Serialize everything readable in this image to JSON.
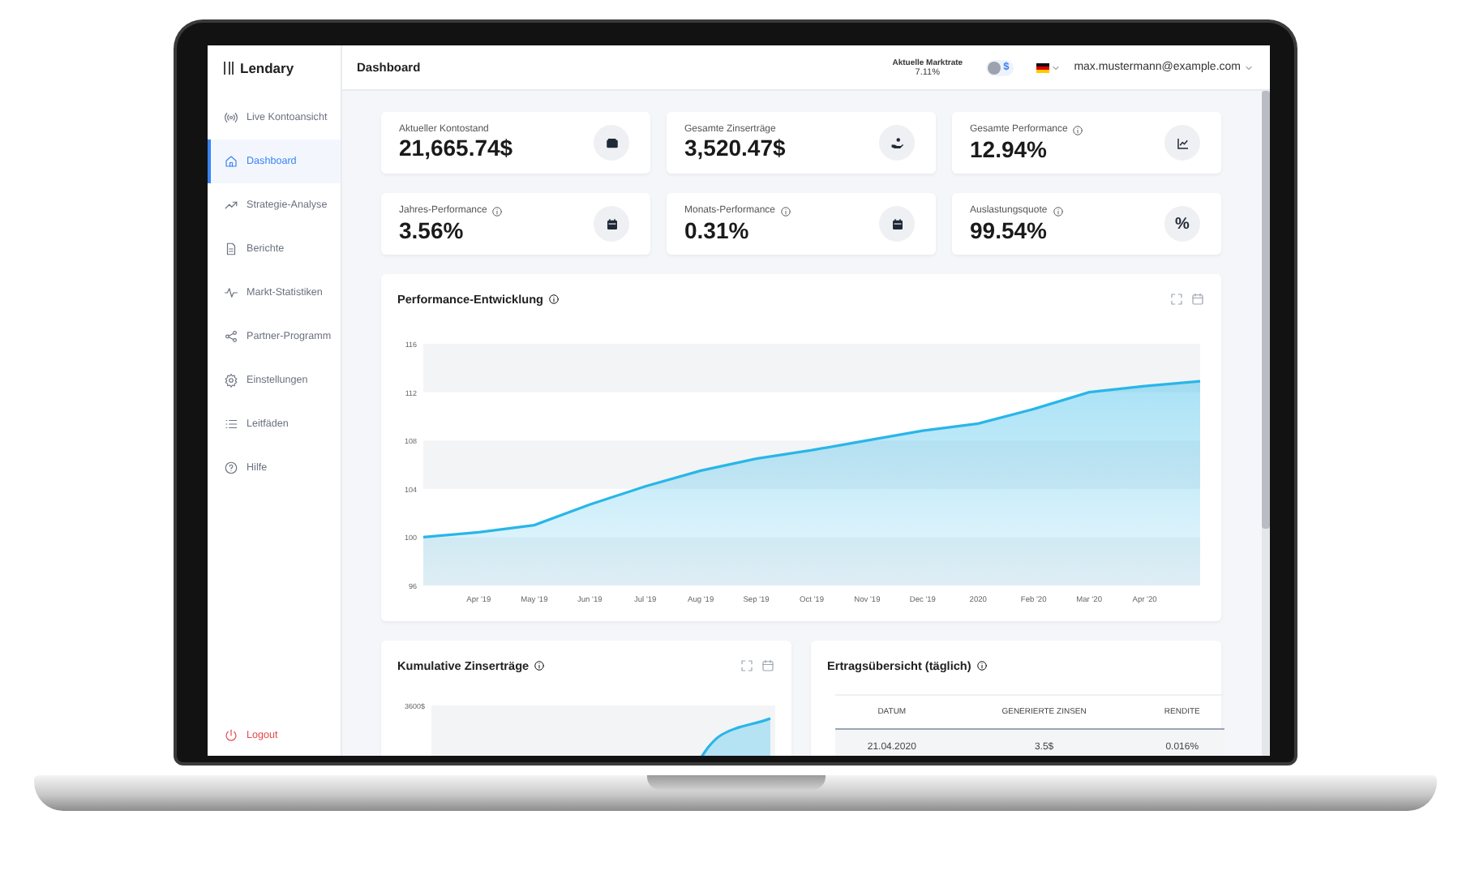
{
  "app": {
    "logo": "Lendary"
  },
  "sidebar": {
    "items": [
      {
        "label": "Live Kontoansicht",
        "kind": "broadcast",
        "selected": false
      },
      {
        "label": "Dashboard",
        "kind": "home",
        "selected": true
      },
      {
        "label": "Strategie-Analyse",
        "kind": "trend",
        "selected": false
      },
      {
        "label": "Berichte",
        "kind": "document",
        "selected": false
      },
      {
        "label": "Markt-Statistiken",
        "kind": "pulse",
        "selected": false
      },
      {
        "label": "Partner-Programm",
        "kind": "share",
        "selected": false
      },
      {
        "label": "Einstellungen",
        "kind": "gear",
        "selected": false
      },
      {
        "label": "Leitfäden",
        "kind": "list",
        "selected": false
      },
      {
        "label": "Hilfe",
        "kind": "help",
        "selected": false
      }
    ],
    "logout": "Logout"
  },
  "topbar": {
    "title": "Dashboard",
    "market_rate": {
      "label": "Aktuelle Marktrate",
      "value": "7.11%"
    },
    "currency": "$",
    "user": "max.mustermann@example.com"
  },
  "stats": [
    {
      "label": "Aktueller Kontostand",
      "value": "21,665.74$",
      "info": false,
      "kind": "wallet"
    },
    {
      "label": "Gesamte Zinserträge",
      "value": "3,520.47$",
      "info": false,
      "kind": "hand"
    },
    {
      "label": "Gesamte Performance",
      "value": "12.94%",
      "info": true,
      "kind": "chart"
    },
    {
      "label": "Jahres-Performance",
      "value": "3.56%",
      "info": true,
      "kind": "calendar"
    },
    {
      "label": "Monats-Performance",
      "value": "0.31%",
      "info": true,
      "kind": "calendar"
    },
    {
      "label": "Auslastungsquote",
      "value": "99.54%",
      "info": true,
      "kind": "symbol",
      "symbol": "%"
    }
  ],
  "performance_chart": {
    "title": "Performance-Entwicklung",
    "chart_data": {
      "type": "area",
      "categories": [
        null,
        "Apr '19",
        "May '19",
        "Jun '19",
        "Jul '19",
        "Aug '19",
        "Sep '19",
        "Oct '19",
        "Nov '19",
        "Dec '19",
        "2020",
        "Feb '20",
        "Mar '20",
        "Apr '20",
        null
      ],
      "series": [
        {
          "color": "#29b6e8",
          "values": [
            100,
            100.4,
            101,
            102.7,
            104.2,
            105.5,
            106.5,
            107.2,
            108,
            108.8,
            109.4,
            110.6,
            112,
            112.5,
            112.9
          ]
        }
      ],
      "ylim": [
        96,
        116
      ],
      "yticks": [
        96,
        100,
        104,
        108,
        112,
        116
      ]
    }
  },
  "cumulative_chart": {
    "title": "Kumulative Zinserträge",
    "y_tick": "3600$"
  },
  "earnings_table": {
    "title": "Ertragsübersicht (täglich)",
    "columns": [
      "DATUM",
      "GENERIERTE ZINSEN",
      "RENDITE"
    ],
    "rows": [
      [
        "21.04.2020",
        "3.5$",
        "0.016%"
      ]
    ]
  }
}
